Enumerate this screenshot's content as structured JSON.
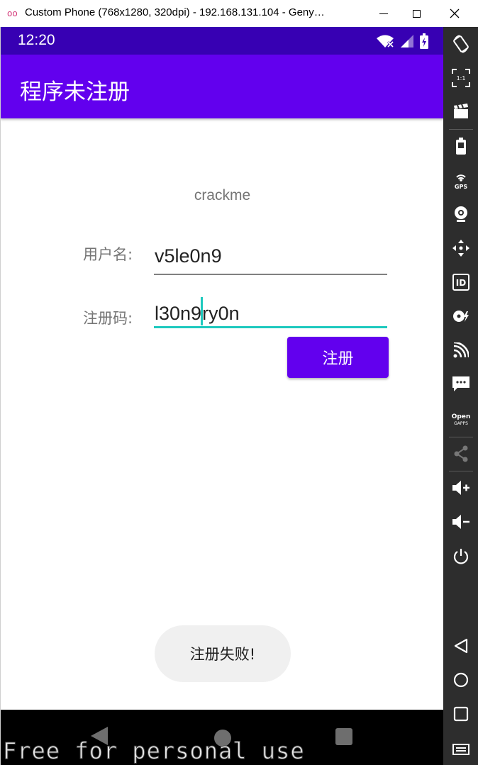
{
  "window": {
    "title": "Custom Phone (768x1280, 320dpi) - 192.168.131.104 - Geny…",
    "controls": [
      "minimize-icon",
      "maximize-icon",
      "close-icon"
    ]
  },
  "statusbar": {
    "time": "12:20",
    "icons": [
      "wifi-off-icon",
      "signal-icon",
      "battery-charging-icon"
    ]
  },
  "appbar": {
    "title": "程序未注册"
  },
  "main": {
    "header": "crackme",
    "username_label": "用户名:",
    "username_value": "v5le0n9",
    "code_label": "注册码:",
    "code_value_before_cursor": "l30n9",
    "code_value_after_cursor": "ry0n",
    "register_button": "注册"
  },
  "toast": {
    "message": "注册失败!"
  },
  "navbar": {
    "icons": [
      "back-icon",
      "home-icon",
      "recents-icon"
    ]
  },
  "watermark": "Free for personal use",
  "colors": {
    "statusbar": "#3700b3",
    "appbar": "#6200ee",
    "accent": "#1ec9be",
    "sidebar": "#2d2d2d"
  },
  "sidebar": {
    "buttons": [
      {
        "name": "rotate-screen-icon",
        "label": ""
      },
      {
        "name": "pixel-perfect-icon",
        "label": "1:1"
      },
      {
        "name": "screencast-icon",
        "label": ""
      },
      {
        "name": "battery-icon",
        "label": ""
      },
      {
        "name": "gps-icon",
        "label": "GPS"
      },
      {
        "name": "webcam-icon",
        "label": ""
      },
      {
        "name": "dpad-icon",
        "label": ""
      },
      {
        "name": "identifiers-icon",
        "label": "ID"
      },
      {
        "name": "disk-io-icon",
        "label": ""
      },
      {
        "name": "network-icon",
        "label": ""
      },
      {
        "name": "sms-icon",
        "label": ""
      },
      {
        "name": "open-gapps-icon",
        "label": "Open GAPPS"
      },
      {
        "name": "share-icon",
        "label": ""
      },
      {
        "name": "volume-up-icon",
        "label": ""
      },
      {
        "name": "volume-down-icon",
        "label": ""
      },
      {
        "name": "power-icon",
        "label": ""
      },
      {
        "name": "back-icon",
        "label": ""
      },
      {
        "name": "home-icon",
        "label": ""
      },
      {
        "name": "recent-apps-icon",
        "label": ""
      },
      {
        "name": "menu-icon",
        "label": ""
      }
    ]
  }
}
